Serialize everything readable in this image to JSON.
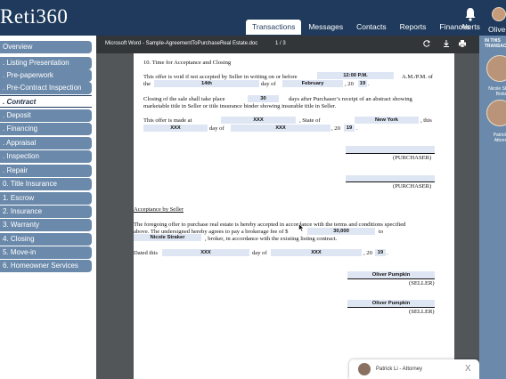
{
  "app": {
    "logo": "Reti360",
    "nav": [
      "Transactions",
      "Messages",
      "Contacts",
      "Reports",
      "Finances"
    ],
    "alerts_label": "Alerts",
    "user_label": "Olive"
  },
  "sidebar": {
    "steps": [
      {
        "label": "Overview",
        "active": false
      },
      {
        "label": ". Listing Presentation",
        "active": false
      },
      {
        "label": ". Pre-paperwork",
        "active": false
      },
      {
        "label": ". Pre-Contract Inspection",
        "active": false
      },
      {
        "label": ". Contract",
        "active": true
      },
      {
        "label": ". Deposit",
        "active": false
      },
      {
        "label": ". Financing",
        "active": false
      },
      {
        "label": ". Appraisal",
        "active": false
      },
      {
        "label": ". Inspection",
        "active": false
      },
      {
        "label": ". Repair",
        "active": false
      },
      {
        "label": "0. Title Insurance",
        "active": false
      },
      {
        "label": "1. Escrow",
        "active": false
      },
      {
        "label": "2. Insurance",
        "active": false
      },
      {
        "label": "3. Warranty",
        "active": false
      },
      {
        "label": "4. Closing",
        "active": false
      },
      {
        "label": "5. Move-in",
        "active": false
      },
      {
        "label": "6. Homeowner Services",
        "active": false
      }
    ]
  },
  "viewer": {
    "title": "Microsoft Word - Sample-AgreementToPurchaseReal Estate.doc",
    "page_indicator": "1 / 3"
  },
  "document": {
    "heading": "10. Time for Acceptance and Closing",
    "p1_a": "This offer is void if not accepted by Seller in writing on or before",
    "p1_time": "12:00 P.M.",
    "p1_ampm": "A.M./P.M. of",
    "p1_the": "the",
    "p1_day_val": "14th",
    "p1_dayof": "day of",
    "p1_month": "February",
    "p1_20": ", 20",
    "p1_year": "19",
    "p1_period": ".",
    "p2_a": "Closing of the sale shall take place",
    "p2_days": "30",
    "p2_b": "days after Purchaser’s receipt of an abstract showing",
    "p2_c": "marketable title in Seller or title insurance binder showing insurable title in Seller.",
    "p3_a": "This    offer    is    made    at",
    "p3_city": "XXX",
    "p3_state_lbl": ",    State    of",
    "p3_state": "New York",
    "p3_this": ",    this",
    "p3_day": "XXX",
    "p3_dayof": "day of",
    "p3_month": "XXX",
    "p3_20": ", 20",
    "p3_year": "19",
    "p3_period": ".",
    "purchaser1": "(PURCHASER)",
    "purchaser2": "(PURCHASER)",
    "acc_heading": "Acceptance by Seller",
    "acc1": "The foregoing offer to purchase real estate is hereby accepted in accordance with the terms and conditions specified",
    "acc2": "above.  The undersigned hereby agrees to pay a brokerage fee of $",
    "acc_fee": "30,000",
    "acc_to": "to",
    "acc_broker": "Nicole Straker",
    "acc3": ", broker, in accordance with the existing listing contract.",
    "dated": "Dated this",
    "dated_day": "XXX",
    "dated_dayof": "day of",
    "dated_month": "XXX",
    "dated_20": ", 20",
    "dated_year": "19",
    "dated_period": ".",
    "seller1_name": "Oliver Pumpkin",
    "seller1": "(SELLER)",
    "seller2_name": "Oliver Pumpkin",
    "seller2": "(SELLER)"
  },
  "chat": {
    "name": "Patrick Li - Attorney",
    "close": "X"
  },
  "right_panel": {
    "title": "IN THIS TRANSACTION",
    "people": [
      {
        "name": "Nicole Straker Broker"
      },
      {
        "name": "Patrick Li Attorney"
      }
    ]
  }
}
